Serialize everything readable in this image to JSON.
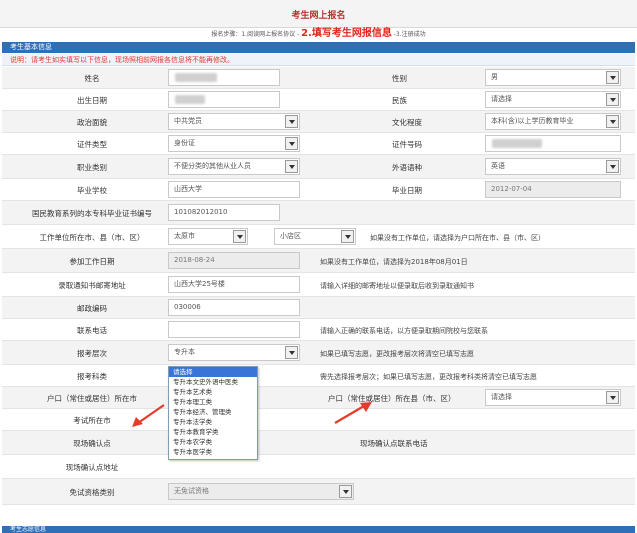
{
  "header": {
    "title": "考生网上报名",
    "steps_prefix": "报名步骤：1.阅读网上报名协议 -",
    "steps_current": "2.填写考生网报信息",
    "steps_suffix": "-3.注册成功"
  },
  "section": {
    "title": "考生基本信息",
    "notice": "说明：请考生如实填写以下信息，现场照相前网报各信息将不能再修改。"
  },
  "form": {
    "name": {
      "label": "姓名",
      "value": ""
    },
    "gender": {
      "label": "性别",
      "value": "男"
    },
    "birth": {
      "label": "出生日期",
      "value": ""
    },
    "ethnicity": {
      "label": "民族",
      "value": "请选择"
    },
    "politics": {
      "label": "政治面貌",
      "value": "中共党员"
    },
    "education": {
      "label": "文化程度",
      "value": "本科(含)以上学历教育毕业"
    },
    "id_type": {
      "label": "证件类型",
      "value": "身份证"
    },
    "id_number": {
      "label": "证件号码",
      "value": ""
    },
    "occupation": {
      "label": "职业类别",
      "value": "不便分类的其他从业人员"
    },
    "foreign_lang": {
      "label": "外语语种",
      "value": "英语"
    },
    "school": {
      "label": "毕业学校",
      "value": "山西大学"
    },
    "grad_date": {
      "label": "毕业日期",
      "value": "2012-07-04"
    },
    "cert_no": {
      "label": "国民教育系列的本专科毕业证书编号",
      "value": "101082012010"
    },
    "work_loc": {
      "label": "工作单位所在市、县（市、区）",
      "city": "太原市",
      "district": "小店区",
      "hint": "如果没有工作单位，请选择为户口所在市、县（市、区）"
    },
    "work_date": {
      "label": "参加工作日期",
      "value": "2018-08-24",
      "hint": "如果没有工作单位，请选择为2018年08月01日"
    },
    "mail_addr": {
      "label": "录取通知书邮寄地址",
      "value": "山西大学25号楼",
      "hint": "请输入详细的邮寄地址以便录取后收到录取通知书"
    },
    "postcode": {
      "label": "邮政编码",
      "value": "030006"
    },
    "phone": {
      "label": "联系电话",
      "value": "",
      "hint": "请输入正确的联系电话，以方便录取期间院校与您联系"
    },
    "level": {
      "label": "报考层次",
      "value": "专升本",
      "hint": "如果已填写志愿，更改报考层次将清空已填写志愿"
    },
    "category": {
      "label": "报考科类",
      "hint": "需先选择报考层次；如果已填写志愿，更改报考科类将清空已填写志愿"
    },
    "hukou_city": {
      "label": "户口（常住或居住）所在市"
    },
    "hukou_county": {
      "label": "户口（常住或居住）所在县（市、区）",
      "value": "请选择"
    },
    "exam_city": {
      "label": "考试所在市"
    },
    "confirm_point": {
      "label": "现场确认点",
      "phone_label": "现场确认点联系电话"
    },
    "confirm_addr": {
      "label": "现场确认点地址"
    },
    "exemption": {
      "label": "免试资格类别",
      "value": "无免试资格"
    }
  },
  "category_options": [
    "请选择",
    "专升本文史外语中医类",
    "专升本艺术类",
    "专升本理工类",
    "专升本经济、管理类",
    "专升本法学类",
    "专升本教育学类",
    "专升本农学类",
    "专升本医学类"
  ],
  "category_selected": "请选择",
  "footer": {
    "title": "考生志愿信息"
  },
  "colors": {
    "accent": "#2e6fb7",
    "notice": "#e23b2e",
    "arrow": "#e43b2a"
  }
}
